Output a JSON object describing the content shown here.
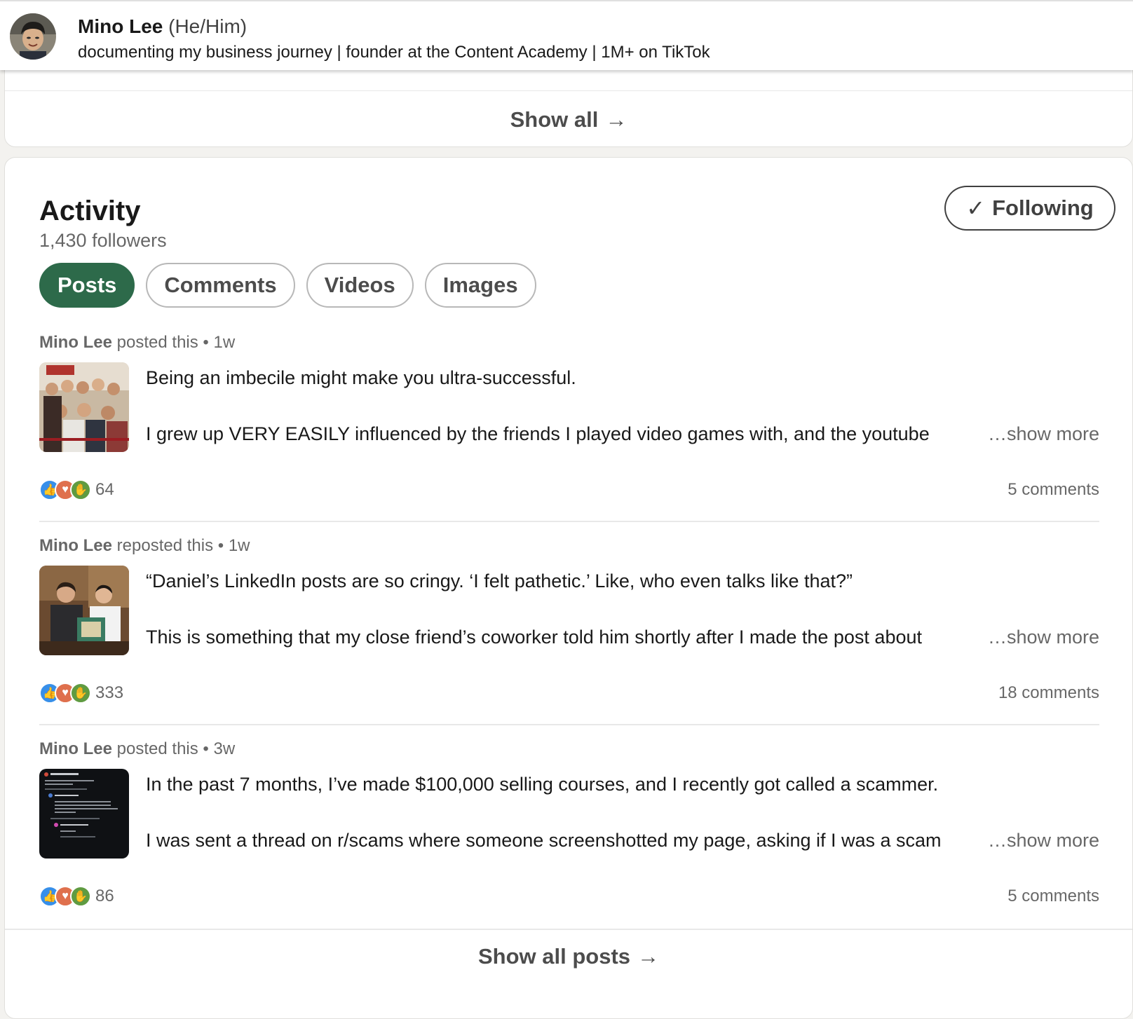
{
  "header": {
    "name": "Mino Lee",
    "pronouns": "(He/Him)",
    "headline": "documenting my business journey | founder at the Content Academy | 1M+ on TikTok"
  },
  "top_card": {
    "show_all_label": "Show all",
    "arrow": "→"
  },
  "activity": {
    "title": "Activity",
    "followers": "1,430 followers",
    "following_label": "Following",
    "check": "✓",
    "tabs": [
      {
        "label": "Posts",
        "active": true
      },
      {
        "label": "Comments",
        "active": false
      },
      {
        "label": "Videos",
        "active": false
      },
      {
        "label": "Images",
        "active": false
      }
    ],
    "posts": [
      {
        "author": "Mino Lee",
        "action": " posted this • 1w",
        "line1": "Being an imbecile might make you ultra-successful.",
        "line2": "I grew up VERY EASILY influenced by the friends I played video games with, and the youtube",
        "show_more": "…show more",
        "reactions": "64",
        "comments": "5 comments"
      },
      {
        "author": "Mino Lee",
        "action": " reposted this • 1w",
        "line1": "“Daniel’s LinkedIn posts are so cringy. ‘I felt pathetic.’ Like, who even talks like that?”",
        "line2": "This is something that my close friend’s coworker told him shortly after I made the post about",
        "show_more": "…show more",
        "reactions": "333",
        "comments": "18 comments"
      },
      {
        "author": "Mino Lee",
        "action": " posted this • 3w",
        "line1": "In the past 7 months, I’ve made $100,000 selling courses, and I recently got called a scammer.",
        "line2": "I was sent a thread on r/scams where someone screenshotted my page, asking if I was a scam",
        "show_more": "…show more",
        "reactions": "86",
        "comments": "5 comments"
      }
    ],
    "show_all_posts_label": "Show all posts"
  },
  "colors": {
    "accent_green": "#2d6a4a",
    "like_blue": "#378fe9",
    "love_orange": "#df704d",
    "celebrate_green": "#5f9b41"
  }
}
